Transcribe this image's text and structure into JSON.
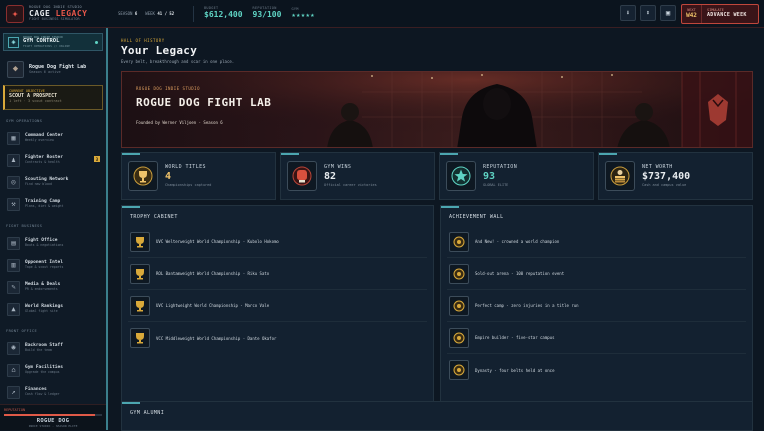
{
  "header": {
    "logo_kicker": "ROGUE DOG INDIE STUDIO",
    "logo_title_a": "CAGE",
    "logo_title_b": "LEGACY",
    "logo_sub": "FIGHT BUSINESS SIMULATOR",
    "season_label": "SEASON",
    "season_value": "6",
    "week_label": "WEEK",
    "week_value": "41 / 52",
    "budget_label": "BUDGET",
    "budget_value": "$612,400",
    "reputation_label": "REPUTATION",
    "reputation_value": "93/100",
    "gym_label": "GYM",
    "gym_stars": "★★★★★",
    "next_label": "NEXT",
    "next_value": "W42",
    "advance_label": "SIMULATE",
    "advance_button": "ADVANCE WEEK"
  },
  "sidebar": {
    "control_kicker": "ROGUE DOG INDIE STUDIO",
    "control_title": "GYM CONTROL",
    "control_sub": "FIGHT OPERATIONS // ONLINE",
    "lab_name": "Rogue Dog Fight Lab",
    "lab_sub": "Season 6 active",
    "objective_label": "CURRENT OBJECTIVE",
    "objective_title": "SCOUT A PROSPECT",
    "objective_sub": "1 left · 3 scout contract",
    "sections": [
      {
        "title": "GYM OPERATIONS",
        "items": [
          {
            "label": "Command Center",
            "sub": "Weekly overview"
          },
          {
            "label": "Fighter Roster",
            "sub": "Contracts & health",
            "badge": "3"
          },
          {
            "label": "Scouting Network",
            "sub": "Find new blood"
          },
          {
            "label": "Training Camp",
            "sub": "Plans, diet & weight"
          }
        ]
      },
      {
        "title": "FIGHT BUSINESS",
        "items": [
          {
            "label": "Fight Office",
            "sub": "Bouts & negotiations"
          },
          {
            "label": "Opponent Intel",
            "sub": "Tape & scout reports"
          },
          {
            "label": "Media & Deals",
            "sub": "PR & endorsements"
          },
          {
            "label": "World Rankings",
            "sub": "Global fight site"
          }
        ]
      },
      {
        "title": "FRONT OFFICE",
        "items": [
          {
            "label": "Backroom Staff",
            "sub": "Build the team"
          },
          {
            "label": "Gym Facilities",
            "sub": "Upgrade the campus"
          },
          {
            "label": "Finances",
            "sub": "Cash flow & ledger"
          }
        ]
      }
    ],
    "rep_label": "REPUTATION",
    "rep_fill": 0.93,
    "rep_name": "ROGUE DOG",
    "rep_sub": "INDIE STUDIO · SEASON ELITE"
  },
  "main": {
    "kicker": "HALL OF HISTORY",
    "title": "Your Legacy",
    "subtitle": "Every belt, breakthrough and scar in one place.",
    "hero": {
      "studio": "ROGUE DOG INDIE STUDIO",
      "gym_name": "ROGUE DOG FIGHT LAB",
      "founded": "Founded by Werner Viljoen · Season 6"
    },
    "stats": [
      {
        "label": "WORLD TITLES",
        "value": "4",
        "sub": "Championships captured",
        "color": "#f0c36a",
        "icon": "trophy-icon"
      },
      {
        "label": "GYM WINS",
        "value": "82",
        "sub": "Official career victories",
        "color": "#e8ecef",
        "icon": "boxing-glove-icon"
      },
      {
        "label": "REPUTATION",
        "value": "93",
        "sub": "GLOBAL ELITE",
        "color": "#5fd4c4",
        "icon": "star-medal-icon"
      },
      {
        "label": "NET WORTH",
        "value": "$737,400",
        "sub": "Cash and campus value",
        "color": "#e8ecef",
        "icon": "money-stack-icon"
      }
    ],
    "trophy_title": "TROPHY CABINET",
    "trophies": [
      "UVC Welterweight World Championship - Kubolo Hokomo",
      "ROL Bantamweight World Championship - Riku Sato",
      "UVC Lightweight World Championship - Marco Vale",
      "VCC Middleweight World Championship - Dante Okafor"
    ],
    "achievement_title": "ACHIEVEMENT WALL",
    "achievements": [
      "And New! - crowned a world champion",
      "Sold-out arena - 100 reputation event",
      "Perfect camp - zero injuries in a title run",
      "Empire builder - five-star campus",
      "Dynasty - four belts held at once"
    ],
    "alumni_title": "GYM ALUMNI"
  },
  "colors": {
    "accent_teal": "#5fd4c4",
    "accent_gold": "#f0c36a",
    "accent_red": "#e05a48",
    "background": "#0d1722"
  }
}
